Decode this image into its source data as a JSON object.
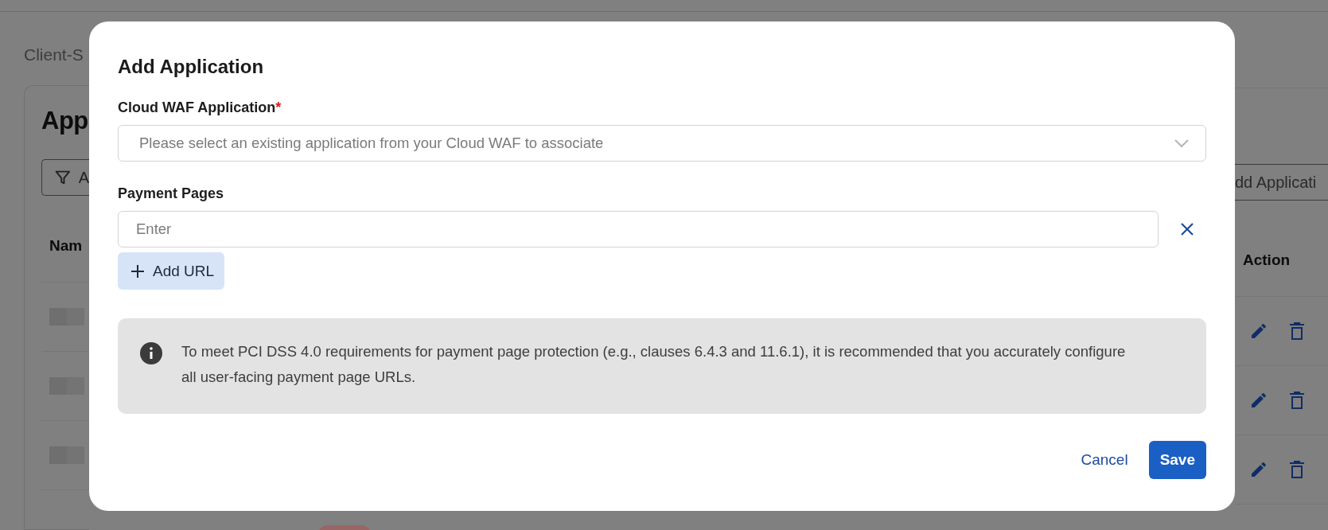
{
  "background": {
    "breadcrumb": "Client-S",
    "heading": "App",
    "filter_button": "A",
    "add_button": "dd Applicati",
    "columns": [
      "Nam",
      "Action"
    ]
  },
  "dialog": {
    "title": "Add Application",
    "cloud_waf": {
      "label": "Cloud WAF Application",
      "required_mark": "*",
      "placeholder": "Please select an existing application from your Cloud WAF to associate"
    },
    "payment_pages": {
      "label": "Payment Pages",
      "placeholder": "Enter"
    },
    "add_url": "Add URL",
    "info": "To meet PCI DSS 4.0 requirements for payment page protection (e.g., clauses 6.4.3 and 11.6.1), it is recommended that you accurately configure all user-facing payment page URLs.",
    "buttons": {
      "cancel": "Cancel",
      "save": "Save"
    }
  }
}
